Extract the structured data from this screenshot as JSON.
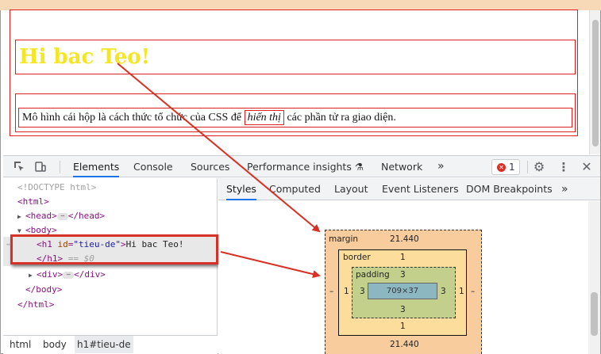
{
  "page": {
    "heading": "Hi bac Teo!",
    "paragraph_before": "Mô hình cái hộp là cách thức tổ chức của CSS để",
    "paragraph_em": "hiển thị",
    "paragraph_after": "các phần tử ra giao diện."
  },
  "devtools_tabs": [
    "Elements",
    "Console",
    "Sources",
    "Performance insights",
    "Network"
  ],
  "devtools_more": "»",
  "error_count": "1",
  "dom_tree": {
    "doctype": "<!DOCTYPE html>",
    "html_open": "<html>",
    "head": "head",
    "body_open": "<body>",
    "h1_tag": "h1",
    "h1_attr_name": "id",
    "h1_attr_value": "\"tieu-de\"",
    "h1_text": "Hi bac Teo!",
    "h1_close": "</h1>",
    "h1_ref": "== $0",
    "div": "div",
    "body_close": "</body>",
    "html_close": "</html>",
    "ellipsis": "⋯"
  },
  "breadcrumbs": [
    "html",
    "body",
    "h1#tieu-de"
  ],
  "styles_tabs": [
    "Styles",
    "Computed",
    "Layout",
    "Event Listeners",
    "DOM Breakpoints"
  ],
  "styles_more": "»",
  "box_model": {
    "margin_label": "margin",
    "margin_top": "21.440",
    "margin_bottom": "21.440",
    "margin_left": "–",
    "margin_right": "–",
    "border_label": "border",
    "border_top": "1",
    "border_bottom": "1",
    "border_left": "1",
    "border_right": "1",
    "padding_label": "padding",
    "padding_top": "3",
    "padding_bottom": "3",
    "padding_left": "3",
    "padding_right": "3",
    "content_size": "709×37"
  },
  "colors": {
    "heading": "#f5e623",
    "outline": "#e02020",
    "active_tab": "#1a73e8",
    "arrow": "#d93025"
  }
}
